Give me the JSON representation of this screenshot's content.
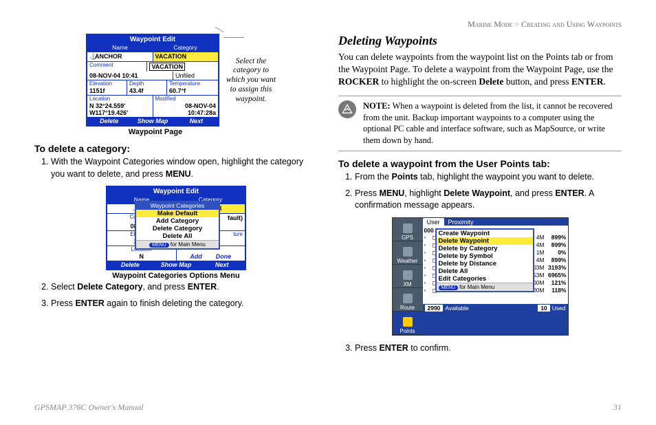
{
  "breadcrumb": {
    "section": "Marine Mode",
    "sep": ">",
    "sub": "Creating and Using Waypoints"
  },
  "left": {
    "fig1": {
      "title": "Waypoint Edit",
      "h_name": "Name",
      "h_cat": "Category",
      "name_val": "ANCHOR",
      "cat_val": "VACATION",
      "cat_val2": "VACATION",
      "cat_unf": "Unfiled",
      "lbl_comment": "Comment",
      "comment_val": "08-NOV-04 10:41",
      "lbl_elev": "Elevation",
      "elev_val": "1151f",
      "lbl_depth": "Depth",
      "depth_val": "43.4f",
      "lbl_temp": "Temperature",
      "temp_val": "60.7°f",
      "lbl_loc": "Location",
      "loc_val1": "N 32°24.559'",
      "loc_val2": "W117°19.426'",
      "lbl_mod": "Modified",
      "mod_val1": "08-NOV-04",
      "mod_val2": "10:47:28a",
      "f_delete": "Delete",
      "f_show": "Show Map",
      "f_next": "Next",
      "caption": "Waypoint Page",
      "hint": "Select the category to which you want to assign this waypoint."
    },
    "h_del_cat": "To delete a category:",
    "step1_a": "With the Waypoint Categories window open, highlight the category you want to delete, and press ",
    "step1_b": "MENU",
    "step1_c": ".",
    "fig2": {
      "title": "Waypoint Edit",
      "h_name": "Name",
      "h_cat": "Category",
      "name_val": "ANC",
      "cat_cell": "VACATI",
      "popup_title": "Waypoint Categories",
      "pi1": "Make Default",
      "pi2": "Add Category",
      "pi3": "Delete Category",
      "pi4": "Delete All",
      "hint_pill": "MENU",
      "hint_txt": "for Main Menu",
      "side_aft": "fault)",
      "lbl_comment": "Comment",
      "comment": "08-NOV",
      "lbl_elev": "Elevation",
      "elev": "1151f",
      "lbl_depth": "",
      "lbl_temp": "ture",
      "lbl_loc": "Location",
      "loc": "N",
      "lbl_mod": "",
      "mod": "",
      "foot_add": "Add",
      "foot_done": "Done",
      "f_delete": "Delete",
      "f_show": "Show Map",
      "f_next": "Next",
      "caption": "Waypoint Categories Options Menu"
    },
    "step2_a": "Select ",
    "step2_b": "Delete Category",
    "step2_c": ", and press ",
    "step2_d": "ENTER",
    "step2_e": ".",
    "step3_a": "Press ",
    "step3_b": "ENTER",
    "step3_c": " again to finish deleting the category."
  },
  "right": {
    "heading": "Deleting Waypoints",
    "p1_a": "You can delete waypoints from the waypoint list on the Points tab or from the Waypoint Page. To delete a waypoint from the Waypoint Page, use the ",
    "p1_b": "ROCKER",
    "p1_c": " to highlight the on-screen ",
    "p1_d": "Delete",
    "p1_e": " button, and press ",
    "p1_f": "ENTER",
    "p1_g": ".",
    "note_label": "NOTE:",
    "note_body": " When a waypoint is deleted from the list, it cannot be recovered from the unit. Backup important waypoints to a computer using the optional PC cable and interface software, such as MapSource, or write them down by hand.",
    "h_del_wp": "To delete a waypoint from the User Points tab:",
    "s1_a": "From the ",
    "s1_b": "Points",
    "s1_c": " tab, highlight the waypoint you want to delete.",
    "s2_a": "Press ",
    "s2_b": "MENU",
    "s2_c": ", highlight ",
    "s2_d": "Delete Waypoint",
    "s2_e": ", and press ",
    "s2_f": "ENTER",
    "s2_g": ". A confirmation message appears.",
    "fig3": {
      "sidetabs": [
        "GPS",
        "Weather",
        "XM",
        "Route",
        "Points"
      ],
      "tab_user": "User",
      "tab_prox": "Proximity",
      "top_num": "000",
      "menu_items": [
        "Create Waypoint",
        "Delete Waypoint",
        "Delete by Category",
        "Delete by Symbol",
        "Delete by Distance",
        "Delete All",
        "Edit Categories"
      ],
      "menu_hl_index": 1,
      "hint_pill": "MENU",
      "hint_txt": "for Main Menu",
      "rows": [
        [
          "4M",
          "899%"
        ],
        [
          "4M",
          "899%"
        ],
        [
          "1M",
          "0%"
        ],
        [
          "4M",
          "899%"
        ],
        [
          "03M",
          "3193%"
        ],
        [
          "53M",
          "6965%"
        ],
        [
          "00M",
          "121%"
        ],
        [
          "00M",
          "118%"
        ]
      ],
      "stat_avail_n": "2990",
      "stat_avail": "Available",
      "stat_used_n": "10",
      "stat_used": "Used"
    },
    "s3_a": "Press ",
    "s3_b": "ENTER",
    "s3_c": " to confirm."
  },
  "footer": {
    "manual": "GPSMAP 376C Owner's Manual",
    "page": "31"
  }
}
